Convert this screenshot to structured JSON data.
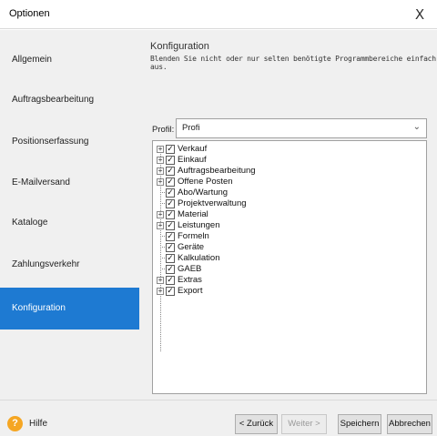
{
  "window": {
    "title": "Optionen",
    "close_glyph": "X"
  },
  "sidebar": {
    "items": [
      {
        "label": "Allgemein",
        "active": false
      },
      {
        "label": "Auftragsbearbeitung",
        "active": false
      },
      {
        "label": "Positionserfassung",
        "active": false
      },
      {
        "label": "E-Mailversand",
        "active": false
      },
      {
        "label": "Kataloge",
        "active": false
      },
      {
        "label": "Zahlungsverkehr",
        "active": false
      },
      {
        "label": "Konfiguration",
        "active": true
      }
    ]
  },
  "main": {
    "heading": "Konfiguration",
    "subheading": "Blenden Sie nicht oder nur selten benötigte Programmbereiche einfach aus.",
    "profil": {
      "label": "Profil:",
      "value": "Profi"
    },
    "tree": [
      {
        "label": "Verkauf",
        "expandable": true,
        "checked": true
      },
      {
        "label": "Einkauf",
        "expandable": true,
        "checked": true
      },
      {
        "label": "Auftragsbearbeitung",
        "expandable": true,
        "checked": true
      },
      {
        "label": "Offene Posten",
        "expandable": true,
        "checked": true
      },
      {
        "label": "Abo/Wartung",
        "expandable": false,
        "checked": true
      },
      {
        "label": "Projektverwaltung",
        "expandable": false,
        "checked": true
      },
      {
        "label": "Material",
        "expandable": true,
        "checked": true
      },
      {
        "label": "Leistungen",
        "expandable": true,
        "checked": true
      },
      {
        "label": "Formeln",
        "expandable": false,
        "checked": true
      },
      {
        "label": "Geräte",
        "expandable": false,
        "checked": true
      },
      {
        "label": "Kalkulation",
        "expandable": false,
        "checked": true
      },
      {
        "label": "GAEB",
        "expandable": false,
        "checked": true
      },
      {
        "label": "Extras",
        "expandable": true,
        "checked": true
      },
      {
        "label": "Export",
        "expandable": true,
        "checked": true
      }
    ]
  },
  "footer": {
    "help_label": "Hilfe",
    "back_label": "< Zurück",
    "next_label": "Weiter >",
    "save_label": "Speichern",
    "cancel_label": "Abbrechen"
  },
  "colors": {
    "accent": "#1e7ad2",
    "help": "#f5a623"
  }
}
